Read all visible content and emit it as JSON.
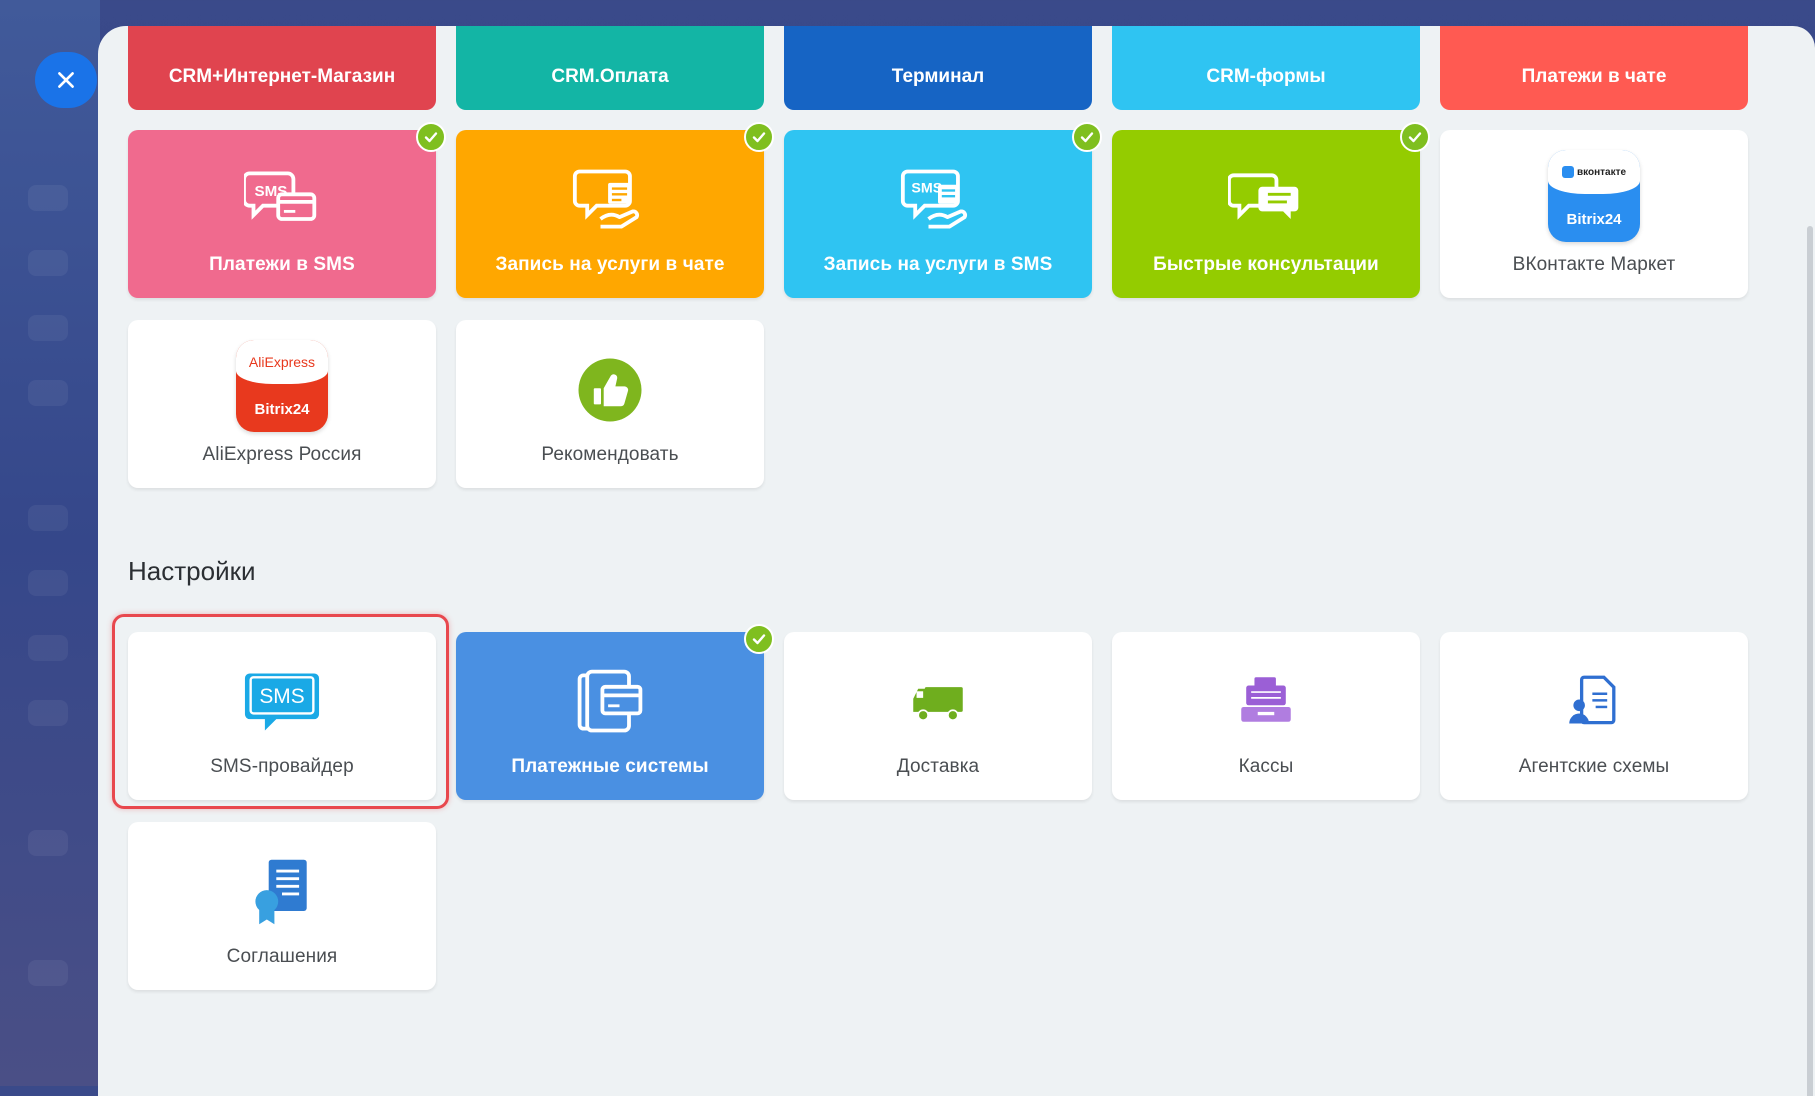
{
  "close_button": {
    "icon": "close-icon"
  },
  "top_row": [
    {
      "label": "CRM+Интернет-Магазин",
      "color": "#e0444f"
    },
    {
      "label": "CRM.Оплата",
      "color": "#13b5a5"
    },
    {
      "label": "Терминал",
      "color": "#1664c4"
    },
    {
      "label": "CRM-формы",
      "color": "#2fc4f2"
    },
    {
      "label": "Платежи в чате",
      "color": "#ff5a52"
    }
  ],
  "sales_tiles": [
    {
      "label": "Платежи в SMS",
      "color": "#f06a8e",
      "checked": true,
      "icon": "sms-card-icon"
    },
    {
      "label": "Запись на услуги в чате",
      "color": "#ffa700",
      "checked": true,
      "icon": "chat-booking-icon"
    },
    {
      "label": "Запись на услуги в SMS",
      "color": "#2fc4f2",
      "checked": true,
      "icon": "sms-booking-icon"
    },
    {
      "label": "Быстрые консультации",
      "color": "#94cc00",
      "checked": true,
      "icon": "chat-bubbles-icon"
    },
    {
      "label": "ВКонтакте Маркет",
      "color": "#ffffff",
      "checked": false,
      "icon": "vk-bitrix-icon",
      "logo_top": "вконтакте",
      "logo_bottom": "Bitrix24"
    }
  ],
  "sales_tiles_row2": [
    {
      "label": "AliExpress Россия",
      "icon": "aliexpress-bitrix-icon",
      "logo_top": "AliExpress",
      "logo_bottom": "Bitrix24"
    },
    {
      "label": "Рекомендовать",
      "icon": "thumbs-up-icon"
    }
  ],
  "settings": {
    "title": "Настройки",
    "tiles": [
      {
        "label": "SMS-провайдер",
        "icon": "sms-icon",
        "icon_text": "SMS",
        "highlighted": true
      },
      {
        "label": "Платежные системы",
        "icon": "payment-systems-icon",
        "color": "#4a90e2",
        "checked": true
      },
      {
        "label": "Доставка",
        "icon": "truck-icon"
      },
      {
        "label": "Кассы",
        "icon": "cash-register-icon"
      },
      {
        "label": "Агентские схемы",
        "icon": "agent-scheme-icon"
      }
    ],
    "tiles_row2": [
      {
        "label": "Соглашения",
        "icon": "agreement-icon"
      }
    ]
  },
  "colors": {
    "panel_bg": "#eef2f4",
    "check": "#7fbf1f",
    "highlight": "#e8484e",
    "accent_blue": "#1a73e8"
  }
}
